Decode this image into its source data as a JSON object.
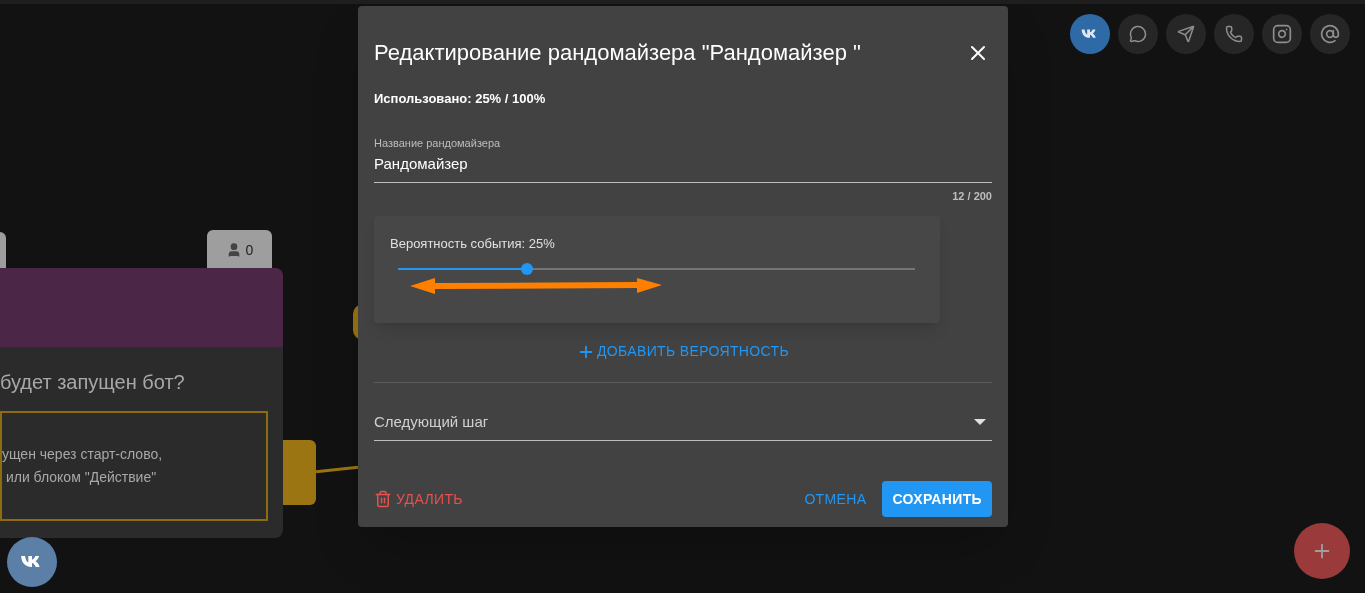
{
  "canvas": {
    "node": {
      "user_count": "0",
      "question": "будет запущен бот?",
      "description": "ущен через старт-слово,\n или блоком \"Действие\""
    }
  },
  "channels": [
    {
      "kind": "vk",
      "selected": true
    },
    {
      "kind": "messenger",
      "selected": false
    },
    {
      "kind": "telegram",
      "selected": false
    },
    {
      "kind": "viber",
      "selected": false
    },
    {
      "kind": "instagram",
      "selected": false
    },
    {
      "kind": "email",
      "selected": false
    }
  ],
  "dialog": {
    "title": "Редактирование рандомайзера \"Рандомайзер \"",
    "usage": "Использовано: 25% / 100%",
    "name_field": {
      "label": "Название рандомайзера",
      "value": "Рандомайзер",
      "counter": "12 / 200"
    },
    "probabilities": [
      {
        "label": "Вероятность события: 25%",
        "level": 0.25
      }
    ],
    "add_button": "ДОБАВИТЬ ВЕРОЯТНОСТЬ",
    "next_step": {
      "placeholder": "Следующий шаг"
    },
    "buttons": {
      "delete": "УДАЛИТЬ",
      "cancel": "ОТМЕНА",
      "save": "СОХРАНИТЬ"
    }
  }
}
